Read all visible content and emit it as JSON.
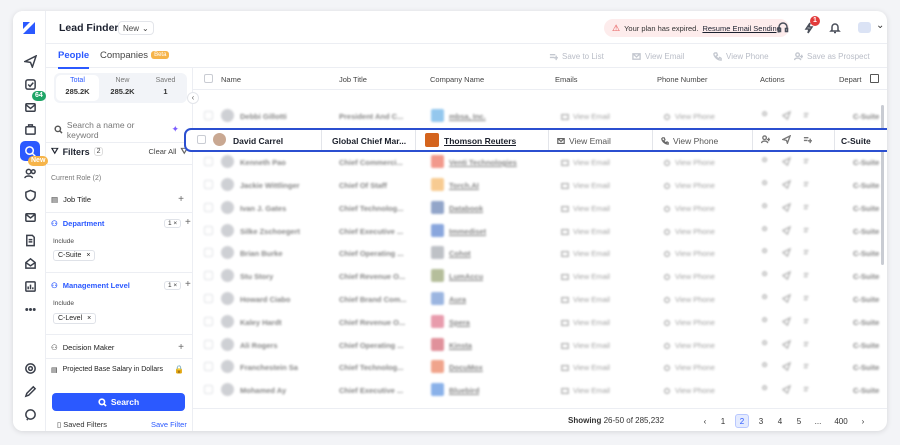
{
  "app": {
    "title": "Lead Finder",
    "view_select": "New"
  },
  "alert": {
    "text": "Your plan has expired.",
    "link": "Resume Email Sending"
  },
  "rail": {
    "badge_count": "64",
    "new_badge": "New",
    "notif_count": "1"
  },
  "tabs": {
    "people": "People",
    "companies": "Companies",
    "companies_badge": "Beta"
  },
  "toolbar": {
    "save_list": "Save to List",
    "view_email": "View Email",
    "view_phone": "View Phone",
    "save_prospect": "Save as Prospect"
  },
  "counts": [
    {
      "label": "Total",
      "value": "285.2K"
    },
    {
      "label": "New",
      "value": "285.2K"
    },
    {
      "label": "Saved",
      "value": "1"
    }
  ],
  "filters": {
    "search_placeholder": "Search a name or keyword",
    "title": "Filters",
    "count": "2",
    "clear": "Clear All",
    "current_role": "Current Role (2)",
    "job_title": "Job Title",
    "department": "Department",
    "dept_count": "1",
    "include": "Include",
    "dept_chip": "C-Suite",
    "mgmt_level": "Management Level",
    "mgmt_count": "1",
    "mgmt_chip": "C-Level",
    "decision_maker": "Decision Maker",
    "salary": "Projected Base Salary in Dollars",
    "search_btn": "Search",
    "saved_filters": "Saved Filters",
    "save_filter": "Save Filter"
  },
  "columns": {
    "name": "Name",
    "job": "Job Title",
    "company": "Company Name",
    "emails": "Emails",
    "phone": "Phone Number",
    "actions": "Actions",
    "dept": "Depart"
  },
  "rows": [
    {
      "name": "Debbi Gillotti",
      "job": "President And C...",
      "company": "mbsa, Inc.",
      "dept": "C-Suite"
    },
    {
      "name": "Kenneth Pao",
      "job": "Chief Commerci...",
      "company": "Venti Technologies",
      "dept": "C-Suite"
    },
    {
      "name": "Jackie Wittlinger",
      "job": "Chief Of Staff",
      "company": "Torch.AI",
      "dept": "C-Suite"
    },
    {
      "name": "Ivan J. Gates",
      "job": "Chief Technolog...",
      "company": "Databook",
      "dept": "C-Suite"
    },
    {
      "name": "Silke Zschoegert",
      "job": "Chief Executive ...",
      "company": "Immediset",
      "dept": "C-Suite"
    },
    {
      "name": "Brian Burke",
      "job": "Chief Operating ...",
      "company": "Cohot",
      "dept": "C-Suite"
    },
    {
      "name": "Stu Story",
      "job": "Chief Revenue O...",
      "company": "LumAccu",
      "dept": "C-Suite"
    },
    {
      "name": "Howard Ciabo",
      "job": "Chief Brand Com...",
      "company": "Aura",
      "dept": "C-Suite"
    },
    {
      "name": "Kaley Hardt",
      "job": "Chief Revenue O...",
      "company": "Spera",
      "dept": "C-Suite"
    },
    {
      "name": "Ali Rogers",
      "job": "Chief Operating ...",
      "company": "Kinsta",
      "dept": "C-Suite"
    },
    {
      "name": "Franchestein Sa",
      "job": "Chief Technolog...",
      "company": "DocuMox",
      "dept": "C-Suite"
    },
    {
      "name": "Mohamed Ay",
      "job": "Chief Executive ...",
      "company": "Bluebird",
      "dept": "C-Suite"
    }
  ],
  "highlight": {
    "name": "David Carrel",
    "job": "Global Chief Mar...",
    "company": "Thomson Reuters",
    "email": "View Email",
    "phone": "View Phone",
    "dept": "C-Suite"
  },
  "row_email": "View Email",
  "row_phone": "View Phone",
  "footer": {
    "showing": "Showing",
    "range": "26-50 of 285,232",
    "pages": [
      "1",
      "2",
      "3",
      "4",
      "5",
      "...",
      "400"
    ],
    "current": "2"
  },
  "colors": {
    "accent": "#2b59ff",
    "highlight_border": "#2b4fd0"
  }
}
